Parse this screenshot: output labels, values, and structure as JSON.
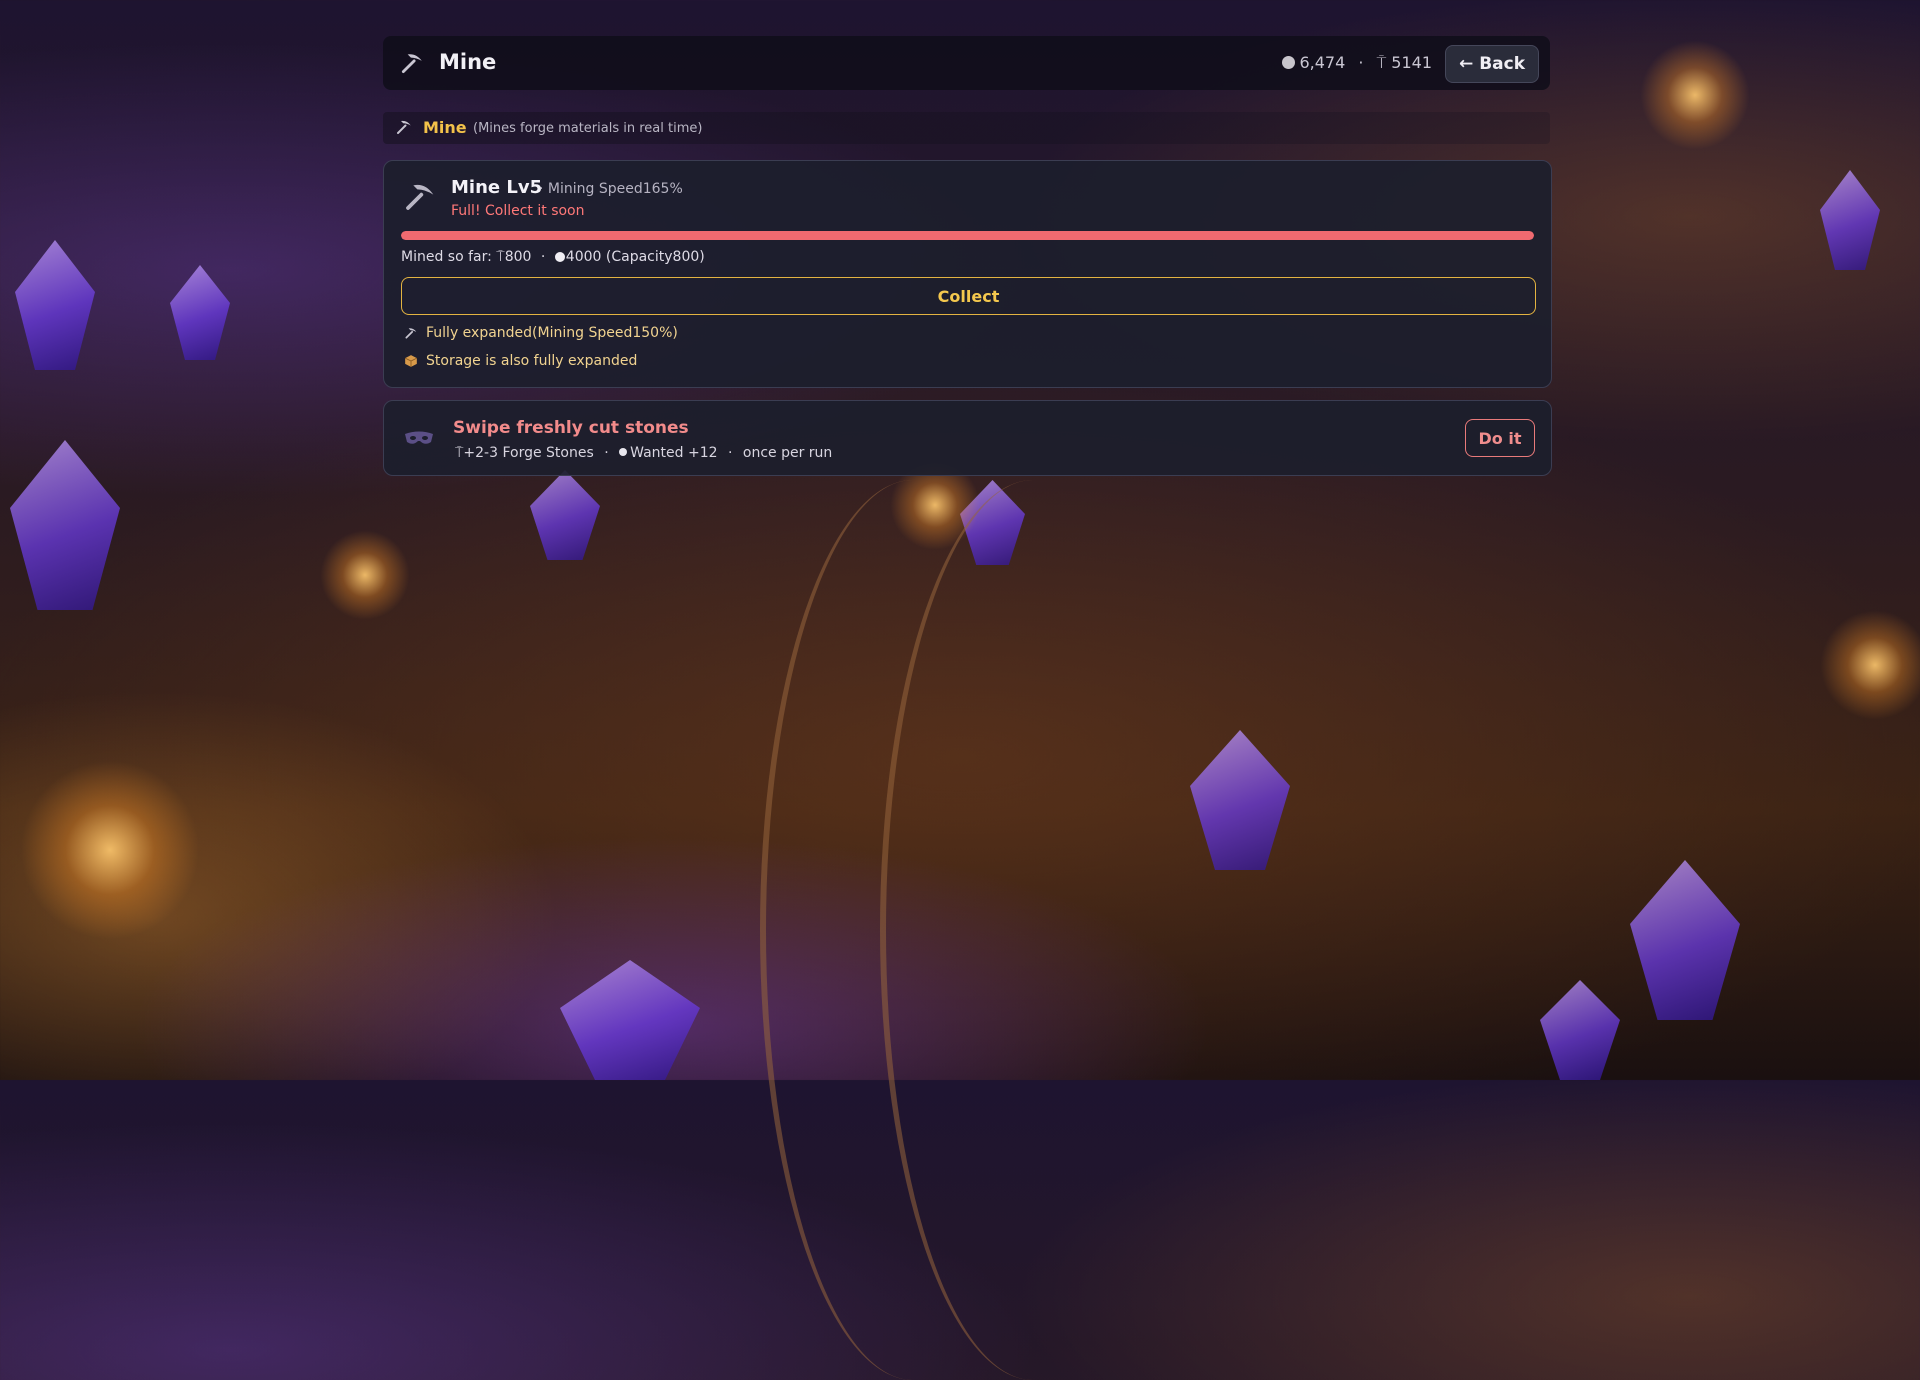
{
  "header": {
    "title": "Mine",
    "coins": "6,474",
    "separator": "·",
    "stones": "5141",
    "stone_symbol": "⍑",
    "back_label": "Back",
    "back_arrow": "←"
  },
  "subheader": {
    "label": "Mine",
    "hint": "(Mines forge materials in real time)"
  },
  "mine": {
    "level_label": "Mine Lv5",
    "speed_text": "· Mining Speed165%",
    "status_text": "Full! Collect it soon",
    "progress": 1.0,
    "mined_label": "Mined so far:",
    "mined_stones": "800",
    "mined_coins": "4000",
    "capacity_text": "(Capacity800)",
    "collect_label": "Collect",
    "note_expanded": "Fully expanded(Mining Speed150%)",
    "note_storage": "Storage is also fully expanded"
  },
  "task": {
    "title": "Swipe freshly cut stones",
    "reward_stones": "+2-3 Forge Stones",
    "reward_wanted": "Wanted +12",
    "frequency": "once per run",
    "action_label": "Do it"
  },
  "colors": {
    "accent_gold": "#e3b341",
    "warn_red": "#f06a70",
    "panel": "#1c1e2c"
  },
  "icons": {
    "header": "pickaxe-icon",
    "mine": "pickaxe-icon",
    "task": "mask-icon",
    "storage": "box-icon",
    "coin": "coin-icon",
    "stone": "forge-stone-icon"
  }
}
